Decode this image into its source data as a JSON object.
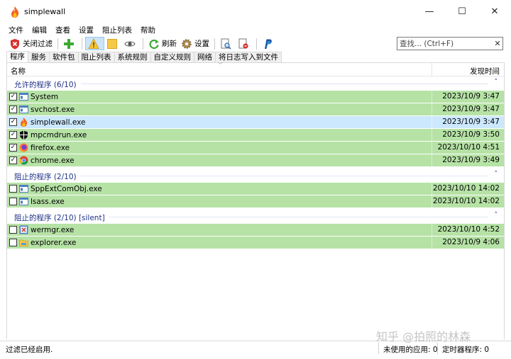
{
  "window": {
    "title": "simplewall",
    "minimize": "—",
    "maximize": "☐",
    "close": "✕"
  },
  "menu": [
    "文件",
    "编辑",
    "查看",
    "设置",
    "阻止列表",
    "帮助"
  ],
  "toolbar": {
    "disable_filter": "关闭过滤",
    "refresh": "刷新",
    "settings": "设置"
  },
  "search": {
    "placeholder": "查找... (Ctrl+F)",
    "clear": "✕"
  },
  "tabs": [
    "程序",
    "服务",
    "软件包",
    "阻止列表",
    "系统规则",
    "自定义规则",
    "网络",
    "将日志写入到文件"
  ],
  "columns": {
    "name": "名称",
    "time": "发现时间"
  },
  "groups": [
    {
      "title": "允许的程序 (6/10)",
      "chevron": "˄",
      "rows": [
        {
          "name": "System",
          "time": "2023/10/9 3:47",
          "checked": true,
          "icon": "window-icon"
        },
        {
          "name": "svchost.exe",
          "time": "2023/10/9 3:47",
          "checked": true,
          "icon": "window-icon"
        },
        {
          "name": "simplewall.exe",
          "time": "2023/10/9 3:47",
          "checked": true,
          "icon": "flame-icon",
          "selected": true
        },
        {
          "name": "mpcmdrun.exe",
          "time": "2023/10/9 3:50",
          "checked": true,
          "icon": "shield-icon"
        },
        {
          "name": "firefox.exe",
          "time": "2023/10/10 4:51",
          "checked": true,
          "icon": "firefox-icon"
        },
        {
          "name": "chrome.exe",
          "time": "2023/10/9 3:49",
          "checked": true,
          "icon": "chrome-icon"
        }
      ]
    },
    {
      "title": "阻止的程序 (2/10)",
      "chevron": "˄",
      "rows": [
        {
          "name": "SppExtComObj.exe",
          "time": "2023/10/10 14:02",
          "checked": false,
          "icon": "window-icon"
        },
        {
          "name": "lsass.exe",
          "time": "2023/10/10 14:02",
          "checked": false,
          "icon": "window-icon"
        }
      ]
    },
    {
      "title": "阻止的程序 (2/10) [silent]",
      "chevron": "˄",
      "rows": [
        {
          "name": "wermgr.exe",
          "time": "2023/10/10 4:52",
          "checked": false,
          "icon": "werror-icon"
        },
        {
          "name": "explorer.exe",
          "time": "2023/10/9 4:06",
          "checked": false,
          "icon": "folder-icon"
        }
      ]
    }
  ],
  "status": {
    "left": "过滤已经启用.",
    "unused": "未使用的应用: 0",
    "timer": "定时器程序: 0"
  },
  "watermark": "知乎 @拍照的林森",
  "colors": {
    "allowed_row": "#b6e2a6",
    "selected_row": "#cce8ff",
    "group_title": "#1e3287"
  }
}
